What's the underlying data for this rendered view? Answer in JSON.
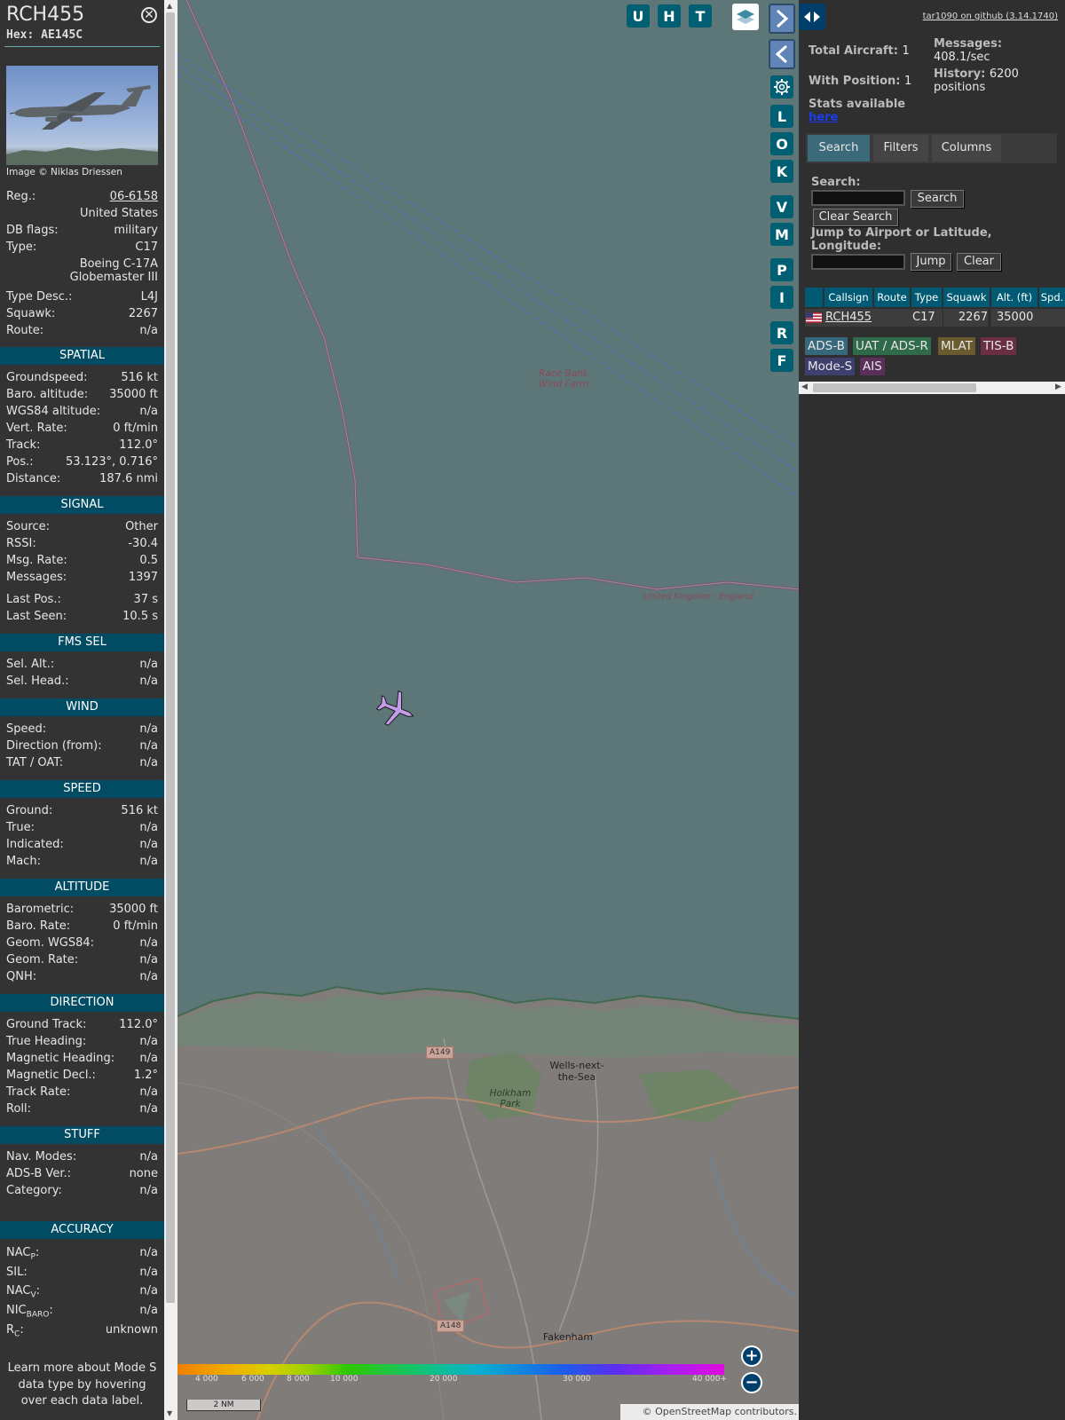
{
  "aircraft": {
    "callsign": "RCH455",
    "hex": "Hex: AE145C",
    "photo_credit": "Image © Niklas Driessen",
    "general": [
      {
        "label": "Reg.:",
        "value": "06-6158"
      },
      {
        "label": "",
        "value": "United States"
      },
      {
        "label": "DB flags:",
        "value": "military"
      },
      {
        "label": "Type:",
        "value": "C17"
      },
      {
        "label": "",
        "value": "Boeing C-17A"
      },
      {
        "label": "",
        "value": "Globemaster III"
      },
      {
        "label": "Type Desc.:",
        "value": "L4J"
      },
      {
        "label": "Squawk:",
        "value": "2267"
      },
      {
        "label": "Route:",
        "value": "n/a"
      }
    ],
    "sections": {
      "spatial": {
        "title": "SPATIAL",
        "rows": [
          {
            "label": "Groundspeed:",
            "value": "516 kt"
          },
          {
            "label": "Baro. altitude:",
            "value": "35000 ft"
          },
          {
            "label": "WGS84 altitude:",
            "value": "n/a"
          },
          {
            "label": "Vert. Rate:",
            "value": "0 ft/min"
          },
          {
            "label": "Track:",
            "value": "112.0°"
          },
          {
            "label": "Pos.:",
            "value": "53.123°, 0.716°"
          },
          {
            "label": "Distance:",
            "value": "187.6 nmi"
          }
        ]
      },
      "signal": {
        "title": "SIGNAL",
        "rows": [
          {
            "label": "Source:",
            "value": "Other"
          },
          {
            "label": "RSSI:",
            "value": "-30.4"
          },
          {
            "label": "Msg. Rate:",
            "value": "0.5"
          },
          {
            "label": "Messages:",
            "value": "1397"
          },
          {
            "label": "Last Pos.:",
            "value": "37 s"
          },
          {
            "label": "Last Seen:",
            "value": "10.5 s"
          }
        ]
      },
      "fms": {
        "title": "FMS SEL",
        "rows": [
          {
            "label": "Sel. Alt.:",
            "value": "n/a"
          },
          {
            "label": "Sel. Head.:",
            "value": "n/a"
          }
        ]
      },
      "wind": {
        "title": "WIND",
        "rows": [
          {
            "label": "Speed:",
            "value": "n/a"
          },
          {
            "label": "Direction (from):",
            "value": "n/a"
          },
          {
            "label": "TAT / OAT:",
            "value": "n/a"
          }
        ]
      },
      "speed": {
        "title": "SPEED",
        "rows": [
          {
            "label": "Ground:",
            "value": "516 kt"
          },
          {
            "label": "True:",
            "value": "n/a"
          },
          {
            "label": "Indicated:",
            "value": "n/a"
          },
          {
            "label": "Mach:",
            "value": "n/a"
          }
        ]
      },
      "altitude": {
        "title": "ALTITUDE",
        "rows": [
          {
            "label": "Barometric:",
            "value": "35000 ft"
          },
          {
            "label": "Baro. Rate:",
            "value": "0 ft/min"
          },
          {
            "label": "Geom. WGS84:",
            "value": "n/a"
          },
          {
            "label": "Geom. Rate:",
            "value": "n/a"
          },
          {
            "label": "QNH:",
            "value": "n/a"
          }
        ]
      },
      "direction": {
        "title": "DIRECTION",
        "rows": [
          {
            "label": "Ground Track:",
            "value": "112.0°"
          },
          {
            "label": "True Heading:",
            "value": "n/a"
          },
          {
            "label": "Magnetic Heading:",
            "value": "n/a"
          },
          {
            "label": "Magnetic Decl.:",
            "value": "1.2°"
          },
          {
            "label": "Track Rate:",
            "value": "n/a"
          },
          {
            "label": "Roll:",
            "value": "n/a"
          }
        ]
      },
      "stuff": {
        "title": "STUFF",
        "rows": [
          {
            "label": "Nav. Modes:",
            "value": "n/a"
          },
          {
            "label": "ADS-B Ver.:",
            "value": "none"
          },
          {
            "label": "Category:",
            "value": "n/a"
          }
        ]
      },
      "accuracy": {
        "title": "ACCURACY",
        "rows": [
          {
            "label": "NAC",
            "sub": "P",
            "value": "n/a"
          },
          {
            "label": "SIL:",
            "sub": "",
            "value": "n/a"
          },
          {
            "label": "NAC",
            "sub": "V",
            "value": "n/a"
          },
          {
            "label": "NIC",
            "sub": "BARO",
            "value": "n/a"
          },
          {
            "label": "R",
            "sub": "C",
            "value": "unknown"
          }
        ]
      }
    },
    "learn_more": "Learn more about Mode S data type by hovering over each data label."
  },
  "map": {
    "top_buttons": [
      "U",
      "H",
      "T"
    ],
    "side_buttons": [
      "L",
      "O",
      "K",
      "V",
      "M",
      "P",
      "I",
      "R",
      "F"
    ],
    "labels": {
      "wind_farm": "Race Bank Wind Farm",
      "border": "United Kingdom · England",
      "town1": "Wells-next-the-Sea",
      "park": "Holkham Park",
      "town2": "Fakenham",
      "road1": "A149",
      "road2": "A148"
    },
    "altitude_ticks": [
      "4 000",
      "6 000",
      "8 000",
      "10 000",
      "20 000",
      "30 000",
      "40 000+"
    ],
    "scale": "2 NM",
    "attribution": "© OpenStreetMap contributors.",
    "icons": {
      "layers": "layers-icon",
      "gear": "gear-icon",
      "zoom_in": "plus-icon",
      "zoom_out": "minus-icon"
    },
    "colors": {
      "water": "#5d7678",
      "aircraft": "#c39be8",
      "accent": "#005f73"
    }
  },
  "sidebar": {
    "version_link": "tar1090 on github (3.14.1740)",
    "total_aircraft_label": "Total Aircraft:",
    "total_aircraft": "1",
    "with_position_label": "With Position:",
    "with_position": "1",
    "messages_label": "Messages:",
    "messages": "408.1/sec",
    "history_label": "History:",
    "history": "6200 positions",
    "stats_label": "Stats available",
    "stats_link": "here",
    "tabs": [
      "Search",
      "Filters",
      "Columns"
    ],
    "search_label": "Search:",
    "search_button": "Search",
    "clear_search_button": "Clear Search",
    "jump_label": "Jump to Airport or Latitude, Longitude:",
    "jump_button": "Jump",
    "clear_button": "Clear",
    "table_headers": [
      "Callsign",
      "Route",
      "Type",
      "Squawk",
      "Alt. (ft)",
      "Spd."
    ],
    "table_rows": [
      {
        "flag": "US",
        "callsign": "RCH455",
        "route": "",
        "type": "C17",
        "squawk": "2267",
        "alt": "35000",
        "spd": ""
      }
    ],
    "source_chips": [
      "ADS-B",
      "UAT / ADS-R",
      "MLAT",
      "TIS-B",
      "Mode-S",
      "AIS"
    ]
  }
}
